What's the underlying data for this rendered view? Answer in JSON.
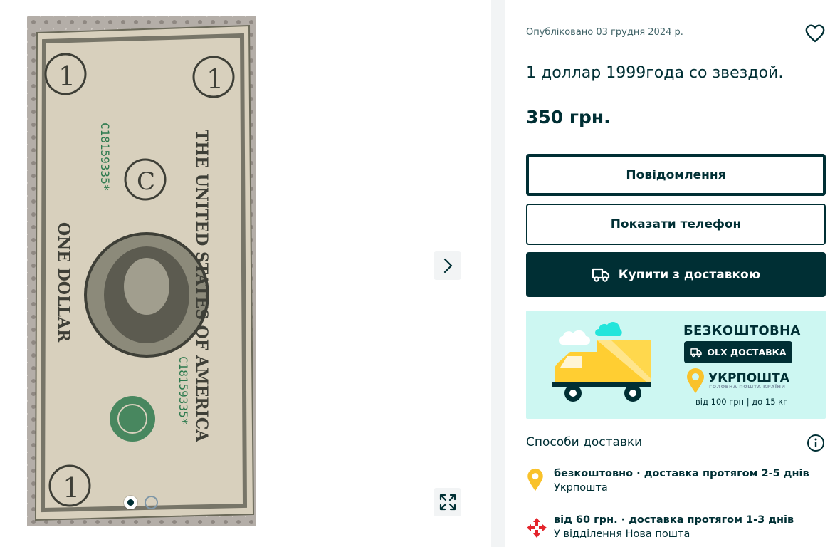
{
  "gallery": {
    "photo_alt": "",
    "slide_count": 2,
    "active_slide": 1
  },
  "listing": {
    "posted": "Опубліковано 03 грудня 2024 р.",
    "title": "1 доллар 1999года со звездой.",
    "price": "350 грн."
  },
  "actions": {
    "message_label": "Повідомлення",
    "phone_label": "Показати телефон",
    "buy_label": "Купити з доставкою"
  },
  "banner": {
    "free": "БЕЗКОШТОВНА",
    "olx": "OLX ДОСТАВКА",
    "carrier": "УКРПОШТА",
    "carrier_sub": "ГОЛОВНА ПОШТА КРАЇНИ",
    "limits": "від 100 грн | до 15 кг"
  },
  "delivery": {
    "heading": "Способи доставки",
    "options": [
      {
        "title": "безкоштовно · доставка протягом 2-5 днів",
        "carrier": "Укрпошта",
        "icon": "ukrposhta-pin-icon",
        "color": "#f9c22b"
      },
      {
        "title": "від 60 грн. · доставка протягом 1-3 днів",
        "carrier": "У відділення Нова пошта",
        "icon": "nova-poshta-icon",
        "color": "#e4242b"
      }
    ]
  },
  "colors": {
    "primary": "#002f34",
    "banner_bg": "#cdf7f2",
    "divider": "#f2f4f5"
  }
}
